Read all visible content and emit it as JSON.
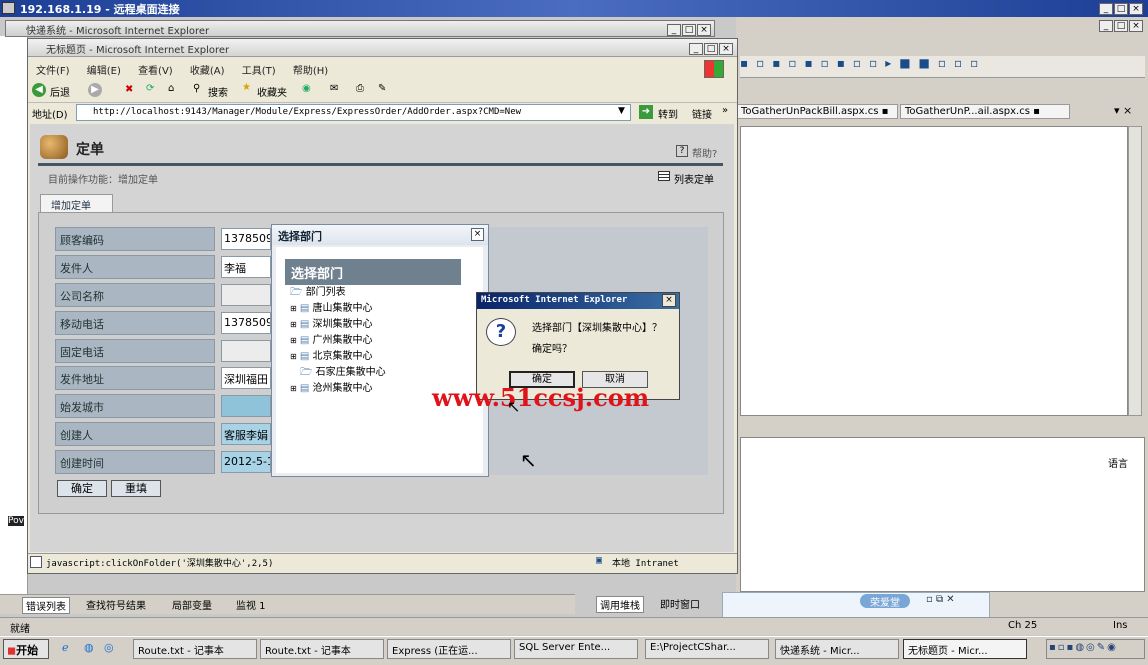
{
  "rdp": {
    "title": "192.168.1.19 - 远程桌面连接"
  },
  "outer_ie": {
    "title": "快递系统 - Microsoft Internet Explorer"
  },
  "ie": {
    "title": "无标题页 - Microsoft Internet Explorer",
    "menu": [
      "文件(F)",
      "编辑(E)",
      "查看(V)",
      "收藏(A)",
      "工具(T)",
      "帮助(H)"
    ],
    "toolbar": {
      "back": "后退",
      "search": "搜索",
      "favorites": "收藏夹"
    },
    "address_label": "地址(D)",
    "url": "http://localhost:9143/Manager/Module/Express/ExpressOrder/AddOrder.aspx?CMD=New",
    "go": "转到",
    "links": "链接",
    "status_left": "javascript:clickOnFolder('深圳集散中心',2,5)",
    "status_right": "本地 Intranet"
  },
  "page": {
    "title": "定单",
    "help": "帮助?",
    "crumb": "目前操作功能：增加定单",
    "list_link": "列表定单",
    "tab": "增加定单",
    "fields": [
      {
        "label": "顾客编码",
        "value": "13785094"
      },
      {
        "label": "发件人",
        "value": "李福"
      },
      {
        "label": "公司名称",
        "value": ""
      },
      {
        "label": "移动电话",
        "value": "13785094"
      },
      {
        "label": "固定电话",
        "value": ""
      },
      {
        "label": "发件地址",
        "value": "深圳福田"
      },
      {
        "label": "始发城市",
        "value": ""
      },
      {
        "label": "创建人",
        "value": "客服李娟"
      },
      {
        "label": "创建时间",
        "value": "2012-5-14"
      }
    ],
    "ok": "确定",
    "reset": "重填"
  },
  "dept_dialog": {
    "title": "选择部门",
    "header": "选择部门",
    "root": "部门列表",
    "items": [
      "唐山集散中心",
      "深圳集散中心",
      "广州集散中心",
      "北京集散中心",
      "石家庄集散中心",
      "沧州集散中心"
    ]
  },
  "confirm": {
    "title": "Microsoft Internet Explorer",
    "message": "选择部门【深圳集散中心】？",
    "question": "确定吗？",
    "ok": "确定",
    "cancel": "取消"
  },
  "watermark": "www.51ccsj.com",
  "vs": {
    "tabs": [
      "ToGatherUnPackBill.aspx.cs",
      "ToGatherUnP...ail.aspx.cs"
    ],
    "bottom_tabs": [
      "错误列表",
      "查找符号结果",
      "局部变量",
      "监视 1"
    ],
    "bottom_tabs2": [
      "调用堆栈",
      "即时窗口"
    ],
    "lang": "语言",
    "rongai": "荣爱堂",
    "ch": "Ch 25",
    "ins": "Ins",
    "status": "就绪",
    "pow": "Pov"
  },
  "taskbar": {
    "start": "开始",
    "items": [
      "Route.txt - 记事本",
      "Route.txt - 记事本",
      "Express (正在运...",
      "SQL Server Ente...",
      "E:\\ProjectCShar...",
      "快递系统 - Micr...",
      "无标题页 - Micr..."
    ]
  }
}
